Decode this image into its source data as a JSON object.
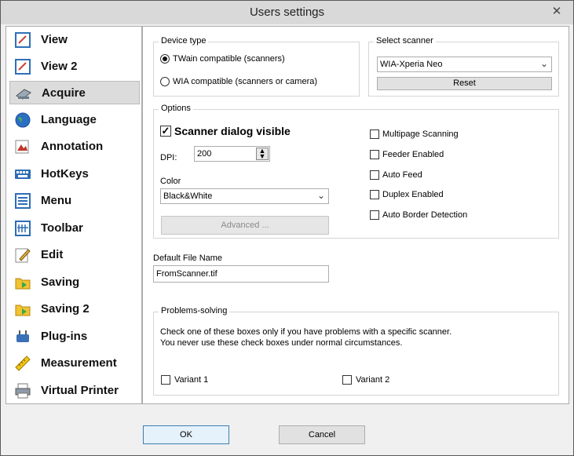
{
  "window": {
    "title": "Users settings",
    "close_glyph": "✕"
  },
  "sidebar": {
    "items": [
      {
        "label": "View",
        "icon": "view-icon"
      },
      {
        "label": "View 2",
        "icon": "view2-icon"
      },
      {
        "label": "Acquire",
        "icon": "scanner-icon",
        "selected": true
      },
      {
        "label": "Language",
        "icon": "globe-icon"
      },
      {
        "label": "Annotation",
        "icon": "annotation-icon"
      },
      {
        "label": "HotKeys",
        "icon": "keyboard-icon"
      },
      {
        "label": "Menu",
        "icon": "menu-icon"
      },
      {
        "label": "Toolbar",
        "icon": "toolbar-icon"
      },
      {
        "label": "Edit",
        "icon": "edit-icon"
      },
      {
        "label": "Saving",
        "icon": "saving-icon"
      },
      {
        "label": "Saving 2",
        "icon": "saving2-icon"
      },
      {
        "label": "Plug-ins",
        "icon": "plugin-icon"
      },
      {
        "label": "Measurement",
        "icon": "ruler-icon"
      },
      {
        "label": "Virtual Printer",
        "icon": "printer-icon"
      }
    ]
  },
  "device_type": {
    "legend": "Device type",
    "twain_label": "TWain compatible (scanners)",
    "wia_label": "WIA compatible (scanners or camera)",
    "selected": "twain"
  },
  "select_scanner": {
    "legend": "Select scanner",
    "value": "WIA-Xperia Neo",
    "reset_label": "Reset"
  },
  "options": {
    "legend": "Options",
    "scanner_dialog_label": "Scanner dialog visible",
    "scanner_dialog_checked": true,
    "dpi_label": "DPI:",
    "dpi_value": "200",
    "color_label": "Color",
    "color_value": "Black&White",
    "advanced_label": "Advanced ...",
    "checks": [
      {
        "label": "Multipage Scanning",
        "checked": false
      },
      {
        "label": "Feeder Enabled",
        "checked": false
      },
      {
        "label": "Auto Feed",
        "checked": false
      },
      {
        "label": "Duplex Enabled",
        "checked": false
      },
      {
        "label": "Auto Border Detection",
        "checked": false
      }
    ]
  },
  "default_file": {
    "label": "Default File Name",
    "value": "FromScanner.tif"
  },
  "problems": {
    "legend": "Problems-solving",
    "line1": "Check one of these boxes only if you have problems with a specific scanner.",
    "line2": "You never use these check boxes under normal circumstances.",
    "variant1": "Variant 1",
    "variant2": "Variant 2"
  },
  "footer": {
    "ok_label": "OK",
    "cancel_label": "Cancel"
  }
}
